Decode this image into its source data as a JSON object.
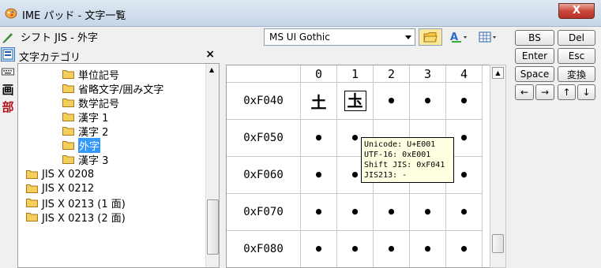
{
  "window": {
    "title": "IME パッド - 文字一覧",
    "close_label": "X"
  },
  "toolbar": {
    "mode_label": "シフト JIS - 外字",
    "font_value": "MS UI Gothic"
  },
  "category": {
    "title": "文字カテゴリ",
    "close": "×",
    "items": [
      {
        "label": "単位記号"
      },
      {
        "label": "省略文字/囲み文字"
      },
      {
        "label": "数学記号"
      },
      {
        "label": "漢字 1"
      },
      {
        "label": "漢字 2"
      },
      {
        "label": "外字",
        "selected": true
      },
      {
        "label": "漢字 3"
      },
      {
        "label": "JIS X 0208"
      },
      {
        "label": "JIS X 0212"
      },
      {
        "label": "JIS X 0213 (1 面)"
      },
      {
        "label": "JIS X 0213 (2 面)"
      }
    ]
  },
  "grid": {
    "columns": [
      "0",
      "1",
      "2",
      "3",
      "4"
    ],
    "rows": [
      {
        "label": "0xF040",
        "cells": [
          "",
          "",
          "•",
          "•",
          "•"
        ]
      },
      {
        "label": "0xF050",
        "cells": [
          "•",
          "•",
          "",
          "",
          "•"
        ]
      },
      {
        "label": "0xF060",
        "cells": [
          "•",
          "•",
          "",
          "",
          "•"
        ]
      },
      {
        "label": "0xF070",
        "cells": [
          "•",
          "•",
          "•",
          "•",
          "•"
        ]
      },
      {
        "label": "0xF080",
        "cells": [
          "•",
          "•",
          "•",
          "•",
          "•"
        ]
      }
    ],
    "glyph_1": "土",
    "glyph_2": "圡"
  },
  "tooltip": {
    "line1": "Unicode: U+E001",
    "line2": "UTF-16: 0xE001",
    "line3": "Shift JIS: 0xF041",
    "line4": "JIS213: -"
  },
  "keys": {
    "bs": "BS",
    "del": "Del",
    "enter": "Enter",
    "esc": "Esc",
    "space": "Space",
    "henkan": "変換",
    "left": "←",
    "right": "→",
    "up": "↑",
    "down": "↓"
  },
  "side_labels": {
    "kaku": "画",
    "bu": "部"
  },
  "colors": {
    "selection": "#3399ff",
    "tooltip_bg": "#ffffe1"
  }
}
